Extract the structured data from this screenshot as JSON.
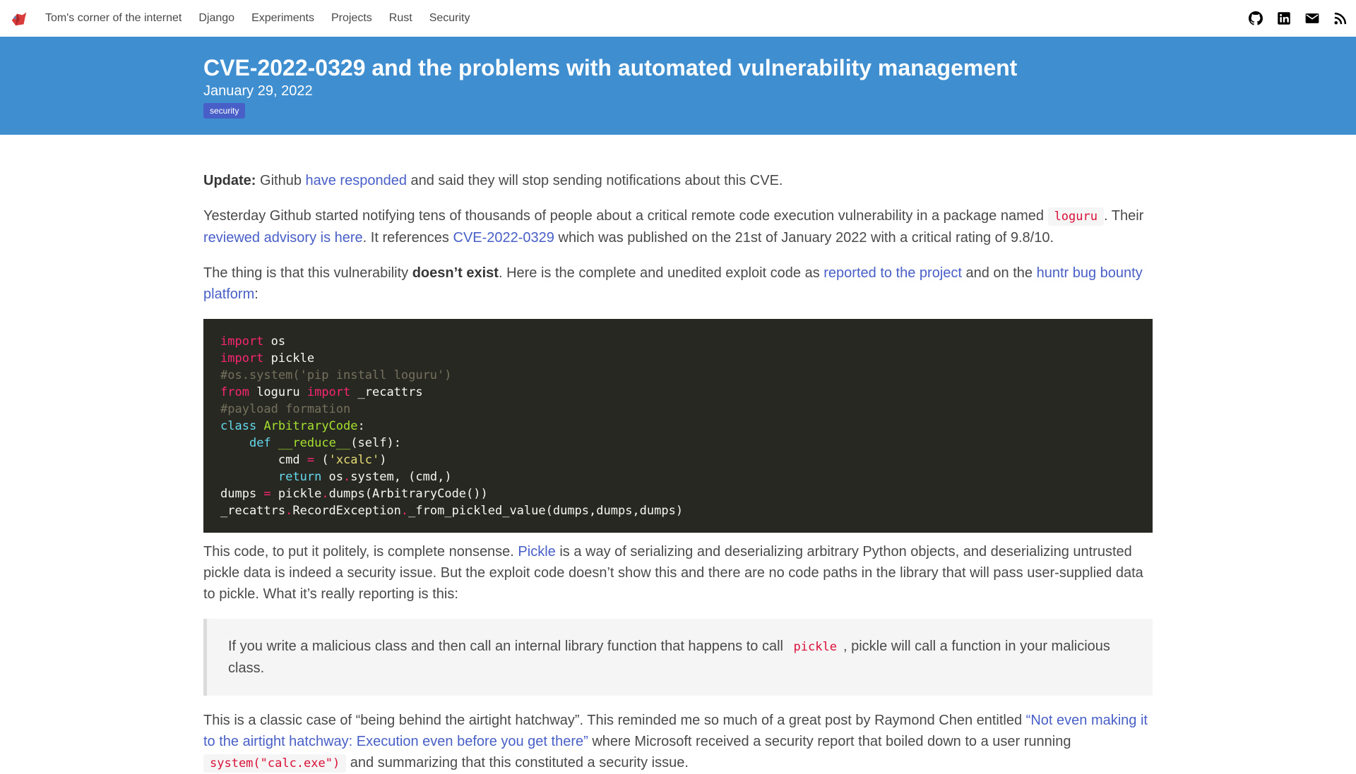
{
  "nav": {
    "brand": "Tom's corner of the internet",
    "items": [
      "Django",
      "Experiments",
      "Projects",
      "Rust",
      "Security"
    ],
    "icons": [
      "github-icon",
      "linkedin-icon",
      "mail-icon",
      "rss-icon"
    ]
  },
  "hero": {
    "title": "CVE-2022-0329 and the problems with automated vulnerability management",
    "date": "January 29, 2022",
    "tag": "security"
  },
  "p1": {
    "strong": "Update:",
    "t1": " Github ",
    "link": "have responded",
    "t2": " and said they will stop sending notifications about this CVE."
  },
  "p2": {
    "t1": "Yesterday Github started notifying tens of thousands of people about a critical remote code execution vulnerability in a package named ",
    "code": "loguru",
    "t2": ". Their ",
    "link1": "reviewed advisory is here",
    "t3": ". It references ",
    "link2": "CVE-2022-0329",
    "t4": " which was published on the 21st of January 2022 with a critical rating of 9.8/10."
  },
  "p3": {
    "t1": "The thing is that this vulnerability ",
    "strong": "doesn’t exist",
    "t2": ". Here is the complete and unedited exploit code as ",
    "link1": "reported to the project",
    "t3": " and on the ",
    "link2": "huntr bug bounty platform",
    "t4": ":"
  },
  "code": {
    "import": "import",
    "from": "from",
    "class": "class",
    "def": "def",
    "return": "return",
    "eq": "=",
    "dot": ".",
    "os": " os",
    "pickle": " pickle",
    "comment1": "#os.system('pip install loguru')",
    "loguru": " loguru ",
    "recattrs": " _recattrs",
    "comment2": "#payload formation",
    "classname": "ArbitraryCode",
    "colon": ":",
    "indent1": "    ",
    "reduce": "__reduce__",
    "selfsig": "(self):",
    "indent2": "        ",
    "cmd": "cmd ",
    "paren_open": " (",
    "xcalc": "'xcalc'",
    "paren_close": ")",
    "os_ret": " os",
    "system_ret": "system, (cmd,)",
    "dumps": "dumps ",
    "pickle2": " pickle",
    "dumps_call": "dumps(ArbitraryCode())",
    "recattrs2": "_recattrs",
    "recordexc": "RecordException",
    "fromvalue": "_from_pickled_value(dumps,dumps,dumps)"
  },
  "p4": {
    "t1": "This code, to put it politely, is complete nonsense. ",
    "link": "Pickle",
    "t2": " is a way of serializing and deserializing arbitrary Python objects, and deserializing untrusted pickle data is indeed a security issue. But the exploit code doesn’t show this and there are no code paths in the library that will pass user-supplied data to pickle. What it’s really reporting is this:"
  },
  "quote": {
    "t1": "If you write a malicious class and then call an internal library function that happens to call ",
    "code": "pickle",
    "t2": ", pickle will call a function in your malicious class."
  },
  "p5": {
    "t1": "This is a classic case of “being behind the airtight hatchway”. This reminded me so much of a great post by Raymond Chen entitled ",
    "link": "“Not even making it to the airtight hatchway: Execution even before you get there”",
    "t2": " where Microsoft received a security report that boiled down to a user running ",
    "code": "system(\"calc.exe\")",
    "t3": " and summarizing that this constituted a security issue."
  }
}
